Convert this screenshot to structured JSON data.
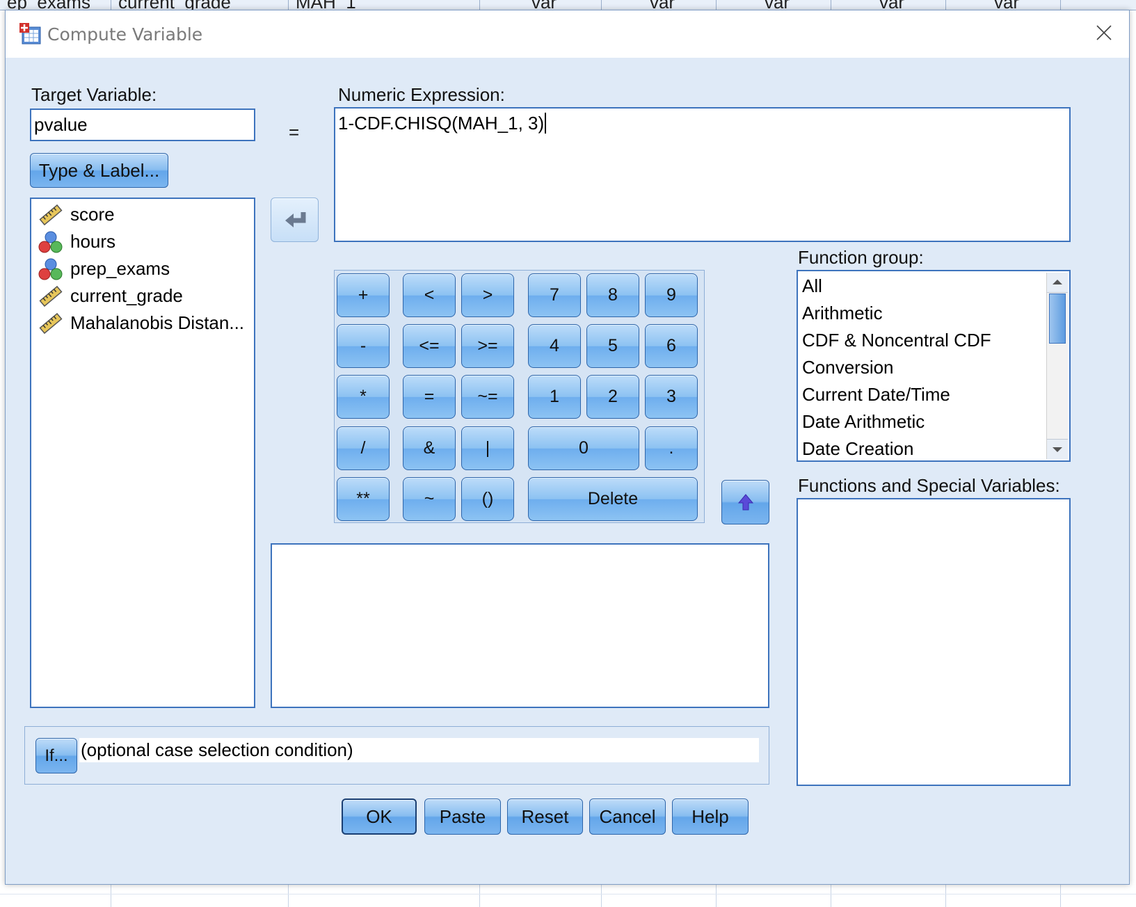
{
  "background": {
    "columns": [
      "ep_exams",
      "current_grade",
      "MAH_1",
      "var",
      "var",
      "var",
      "var",
      "var"
    ]
  },
  "dialog": {
    "title": "Compute Variable",
    "target_variable": {
      "label": "Target Variable:",
      "value": "pvalue"
    },
    "equals": "=",
    "type_label_button": "Type & Label...",
    "variables": [
      {
        "name": "score",
        "icon": "ruler-scale-icon"
      },
      {
        "name": "hours",
        "icon": "nominal-circles-icon"
      },
      {
        "name": "prep_exams",
        "icon": "nominal-circles-icon"
      },
      {
        "name": "current_grade",
        "icon": "ruler-scale-icon"
      },
      {
        "name": "Mahalanobis Distan...",
        "icon": "ruler-scale-icon"
      }
    ],
    "numeric_expression": {
      "label": "Numeric Expression:",
      "value": "1-CDF.CHISQ(MAH_1, 3)"
    },
    "keypad": {
      "plus": "+",
      "lt": "<",
      "gt": ">",
      "k7": "7",
      "k8": "8",
      "k9": "9",
      "minus": "-",
      "le": "<=",
      "ge": ">=",
      "k4": "4",
      "k5": "5",
      "k6": "6",
      "mul": "*",
      "eq": "=",
      "ne": "~=",
      "k1": "1",
      "k2": "2",
      "k3": "3",
      "div": "/",
      "and": "&",
      "or": "|",
      "k0": "0",
      "dot": ".",
      "pow": "**",
      "not": "~",
      "paren": "()",
      "delete": "Delete"
    },
    "function_group": {
      "label": "Function group:",
      "items": [
        "All",
        "Arithmetic",
        "CDF & Noncentral CDF",
        "Conversion",
        "Current Date/Time",
        "Date Arithmetic",
        "Date Creation"
      ]
    },
    "functions_label": "Functions and Special Variables:",
    "if_button": "If...",
    "if_condition": "(optional case selection condition)",
    "buttons": {
      "ok": "OK",
      "paste": "Paste",
      "reset": "Reset",
      "cancel": "Cancel",
      "help": "Help"
    }
  }
}
